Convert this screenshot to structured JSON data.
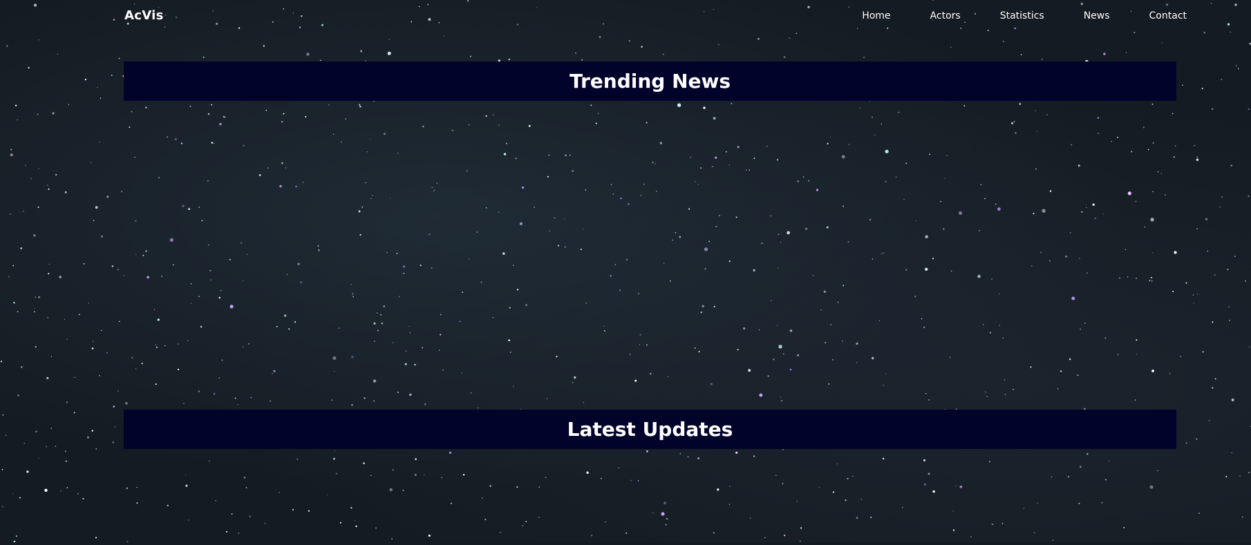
{
  "header": {
    "logo": "AcVis",
    "nav": [
      "Home",
      "Actors",
      "Statistics",
      "News",
      "Contact"
    ]
  },
  "sections": {
    "trending": {
      "title": "Trending News"
    },
    "updates": {
      "title": "Latest Updates"
    }
  },
  "colors": {
    "background": "#141b22",
    "banner": "#02032a",
    "text": "#ffffff"
  }
}
